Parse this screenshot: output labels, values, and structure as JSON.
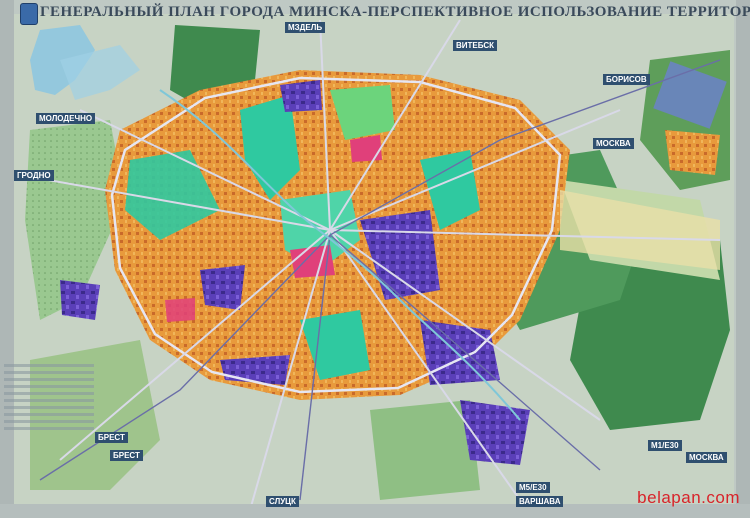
{
  "title": "ГЕНЕРАЛЬНЫЙ ПЛАН ГОРОДА МИНСКА-ПЕРСПЕКТИВНОЕ ИСПОЛЬЗОВАНИЕ ТЕРРИТОРИИ",
  "watermark": "belapan.com",
  "labels": {
    "molodechno": "МОЛОДЕЧНО",
    "vitebsk": "ВИТЕБСК",
    "borisov": "БОРИСОВ",
    "moskva_top": "МОСКВА",
    "grodno": "ГРОДНО",
    "brest1": "БРЕСТ",
    "brest2": "БРЕСТ",
    "varshava": "ВАРШАВА",
    "moskva_bottom": "МОСКВА",
    "m5e30": "M5/E30",
    "m1e30": "M1/E30",
    "sluck": "СЛУЦК",
    "mzdel": "МЗДЕЛЬ"
  },
  "colors": {
    "forest": "#3f8a4e",
    "light_green": "#8fc67a",
    "parks": "#2fc9a0",
    "residential": "#e89a3c",
    "residential_dark": "#c96a2a",
    "industrial": "#5a3fb8",
    "commercial": "#e0407a",
    "water": "#8ec7e0",
    "background": "#bfc9c4",
    "road": "#d9d9e8"
  },
  "icons": [
    "city-emblem-icon"
  ]
}
